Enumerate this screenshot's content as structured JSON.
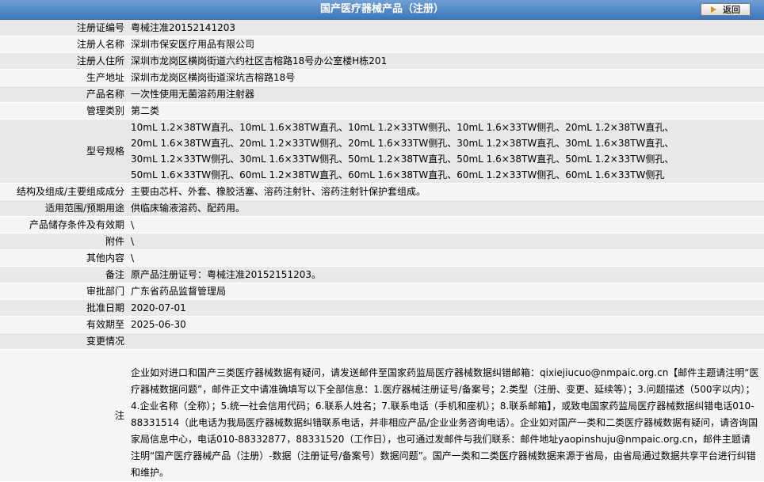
{
  "header": {
    "title": "国产医疗器械产品（注册）",
    "back_label": "返回"
  },
  "fields": {
    "reg_no": {
      "label": "注册证编号",
      "value": "粤械注准20152141203"
    },
    "registrant": {
      "label": "注册人名称",
      "value": "深圳市保安医疗用品有限公司"
    },
    "registrant_addr": {
      "label": "注册人住所",
      "value": "深圳市龙岗区横岗街道六约社区吉榕路18号办公室楼H栋201"
    },
    "production_addr": {
      "label": "生产地址",
      "value": "深圳市龙岗区横岗街道深坑吉榕路18号"
    },
    "product_name": {
      "label": "产品名称",
      "value": "一次性使用无菌溶药用注射器"
    },
    "category": {
      "label": "管理类别",
      "value": "第二类"
    },
    "models": {
      "label": "型号规格",
      "lines": [
        "10mL 1.2×38TW直孔、10mL 1.6×38TW直孔、10mL 1.2×33TW侧孔、10mL 1.6×33TW侧孔、20mL 1.2×38TW直孔、",
        "20mL 1.6×38TW直孔、20mL 1.2×33TW侧孔、20mL 1.6×33TW侧孔、30mL 1.2×38TW直孔、30mL 1.6×38TW直孔、",
        "30mL 1.2×33TW侧孔、30mL 1.6×33TW侧孔、50mL 1.2×38TW直孔、50mL 1.6×38TW直孔、50mL 1.2×33TW侧孔、",
        "50mL 1.6×33TW侧孔、60mL 1.2×38TW直孔、60mL 1.6×38TW直孔、60mL 1.2×33TW侧孔、60mL 1.6×33TW侧孔"
      ]
    },
    "composition": {
      "label": "结构及组成/主要组成成分",
      "value": "主要由芯杆、外套、橡胶活塞、溶药注射针、溶药注射针保护套组成。"
    },
    "scope": {
      "label": "适用范围/预期用途",
      "value": "供临床输液溶药、配药用。"
    },
    "storage": {
      "label": "产品储存条件及有效期",
      "value": "\\"
    },
    "attachment": {
      "label": "附件",
      "value": "\\"
    },
    "other": {
      "label": "其他内容",
      "value": "\\"
    },
    "remarks": {
      "label": "备注",
      "value": "原产品注册证号：粤械注准20152151203。"
    },
    "approval_dept": {
      "label": "审批部门",
      "value": "广东省药品监督管理局"
    },
    "approval_date": {
      "label": "批准日期",
      "value": "2020-07-01"
    },
    "valid_until": {
      "label": "有效期至",
      "value": "2025-06-30"
    },
    "changes": {
      "label": "变更情况",
      "value": ""
    },
    "note": {
      "label": "注",
      "text": "企业如对进口和国产三类医疗器械数据有疑问，请发送邮件至国家药监局医疗器械数据纠错邮箱：qixiejiucuo@nmpaic.org.cn【邮件主题请注明“医疗器械数据问题”，邮件正文中请准确填写以下全部信息：1.医疗器械注册证号/备案号；2.类型（注册、变更、延续等）；3.问题描述（500字以内）；4.企业名称（全称）；5.统一社会信用代码；6.联系人姓名；7.联系电话（手机和座机）；8.联系邮箱】，或致电国家药监局医疗器械数据纠错电话010-88331514（此电话为我局医疗器械数据纠错联系电话，并非相应产品/企业业务咨询电话）。企业如对国产一类和二类医疗器械数据有疑问，请咨询国家局信息中心，电话010-88332877，88331520（工作日），也可通过发邮件与我们联系：邮件地址yaopinshuju@nmpaic.org.cn，邮件主题请注明“国产医疗器械产品（注册）-数据（注册证号/备案号）数据问题”。国产一类和二类医疗器械数据来源于省局，由省局通过数据共享平台进行纠错和维护。"
    }
  },
  "colors": {
    "header_bg": "#3d76bd",
    "row_dark": "#e8e8e8",
    "row_light": "#f5f5f5",
    "back_arrow": "#e08a17"
  }
}
